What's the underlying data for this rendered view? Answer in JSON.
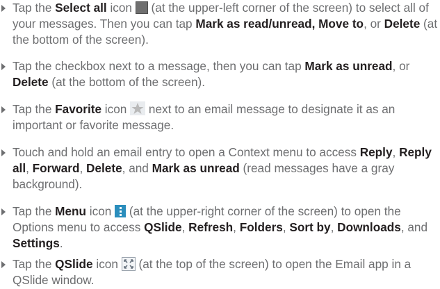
{
  "items": [
    {
      "p1": "Tap the ",
      "b1": "Select all",
      "p2": " icon ",
      "icon": "select-all-icon",
      "p3": " (at the upper-left corner of the screen) to select all of your messages. Then you can tap ",
      "b2": "Mark as read/unread, Move to",
      "p4": ", or ",
      "b3": "Delete",
      "p5": " (at the bottom of the screen)."
    },
    {
      "p1": "Tap the checkbox next to a message, then you can tap ",
      "b1": "Mark as unread",
      "p2": ", or ",
      "b2": "Delete",
      "p3": " (at the bottom of the screen)."
    },
    {
      "p1": "Tap the ",
      "b1": "Favorite",
      "p2": " icon ",
      "icon": "star-icon",
      "p3": " next to an email message to designate it as an important or favorite message."
    },
    {
      "p1": "Touch and hold an email entry to open a Context menu to access ",
      "b1": "Reply",
      "p2": ", ",
      "b2": "Reply all",
      "p3": ", ",
      "b3": "Forward",
      "p4": ", ",
      "b4": "Delete",
      "p5": ", and ",
      "b5": "Mark as unread",
      "p6": " (read messages have a gray background)."
    },
    {
      "p1": "Tap the ",
      "b1": "Menu",
      "p2": " icon ",
      "icon": "menu-icon",
      "p3": " (at the upper-right corner of the screen) to open the Options menu to access ",
      "b2": "QSlide",
      "p4": ", ",
      "b3": "Refresh",
      "p5": ", ",
      "b4": "Folders",
      "p6": ", ",
      "b5": "Sort by",
      "p7": ", ",
      "b6": "Downloads",
      "p8": ", and ",
      "b7": "Settings",
      "p9": "."
    },
    {
      "p1": "Tap the ",
      "b1": "QSlide",
      "p2": " icon ",
      "icon": "qslide-icon",
      "p3": " (at the top of the screen) to open the Email app in a QSlide window."
    }
  ]
}
